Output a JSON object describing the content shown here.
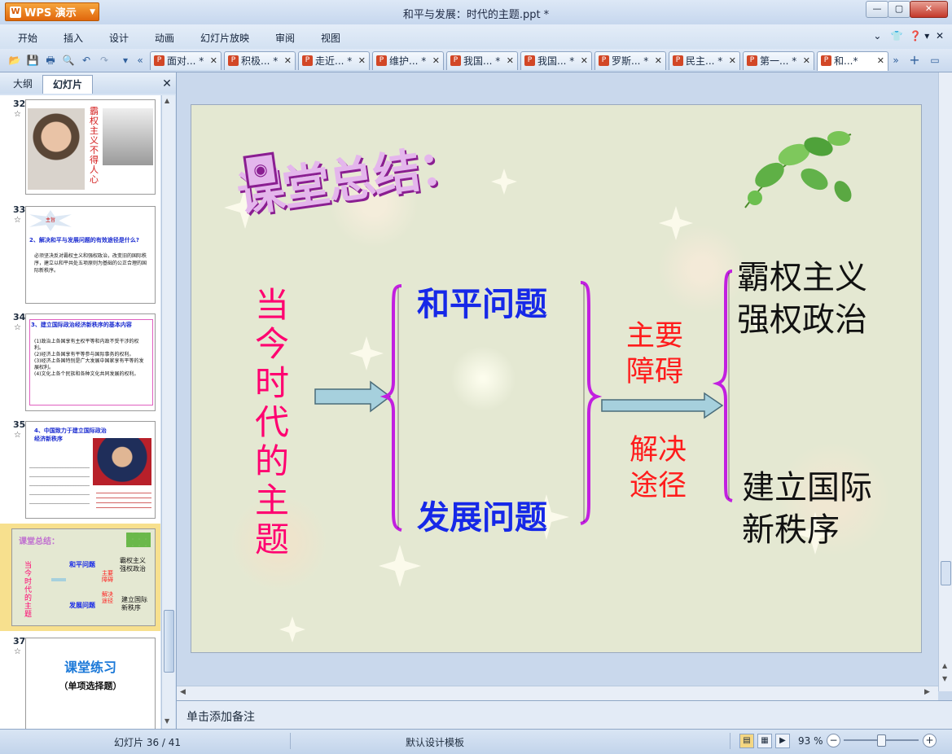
{
  "app": {
    "name": "WPS 演示",
    "title": "和平与发展：时代的主题.ppt *"
  },
  "menu": {
    "items": [
      "开始",
      "插入",
      "设计",
      "动画",
      "幻灯片放映",
      "审阅",
      "视图"
    ]
  },
  "tabs": [
    {
      "label": "面对... *"
    },
    {
      "label": "积极... *"
    },
    {
      "label": "走近... *"
    },
    {
      "label": "维护... *"
    },
    {
      "label": "我国... *"
    },
    {
      "label": "我国... *"
    },
    {
      "label": "罗斯... *"
    },
    {
      "label": "民主... *"
    },
    {
      "label": "第一... *"
    },
    {
      "label": "和...*"
    }
  ],
  "panel": {
    "tab_outline": "大纲",
    "tab_slides": "幻灯片"
  },
  "thumbnails": [
    {
      "number": "32",
      "star": "☆",
      "vertical_text": "霸权主义不得人心"
    },
    {
      "number": "33",
      "star": "☆",
      "badge": "主旨",
      "heading": "2、解决和平与发展问题的有效途径是什么?",
      "body": "必须坚决反对霸权主义和强权政治，改变旧的国际秩序，建立以和平共处五项原则为基础的公正合理的国际新秩序。"
    },
    {
      "number": "34",
      "star": "☆",
      "heading": "3、建立国际政治经济新秩序的基本内容",
      "lines": [
        "(1)政治上各国享有主权平等和内政不受干涉的权利。",
        "(2)经济上各国享有平等参与国际事务的权利。",
        "(3)经济上各国特别是广大发展中国家享有平等的发展权利。",
        "(4)文化上各个民族和各种文化共同发展的权利。"
      ]
    },
    {
      "number": "35",
      "star": "☆",
      "heading": "4、中国致力于建立国际政治经济新秩序"
    },
    {
      "number": "36",
      "star": "",
      "selected": true
    },
    {
      "number": "37",
      "star": "☆",
      "title": "课堂练习",
      "subtitle": "（单项选择题）"
    }
  ],
  "slide": {
    "title": "课堂总结：",
    "vertical_text": "当今时代的主题",
    "issue_peace": "和平问题",
    "issue_development": "发展问题",
    "obstacle": "主要\n障碍",
    "solution": "解决\n途径",
    "hegemony": "霸权主义\n强权政治",
    "new_order": "建立国际\n新秩序",
    "colors": {
      "title": "#e4b6ec",
      "vertical": "#ff0070",
      "blue": "#1628e8",
      "red": "#ff1c1c",
      "brace": "#c21fe0",
      "arrow": "#a6d0dd"
    }
  },
  "notes": {
    "placeholder": "单击添加备注"
  },
  "status": {
    "slide_count": "幻灯片 36 / 41",
    "template": "默认设计模板",
    "zoom": "93 %",
    "zoom_fraction": 0.5
  }
}
